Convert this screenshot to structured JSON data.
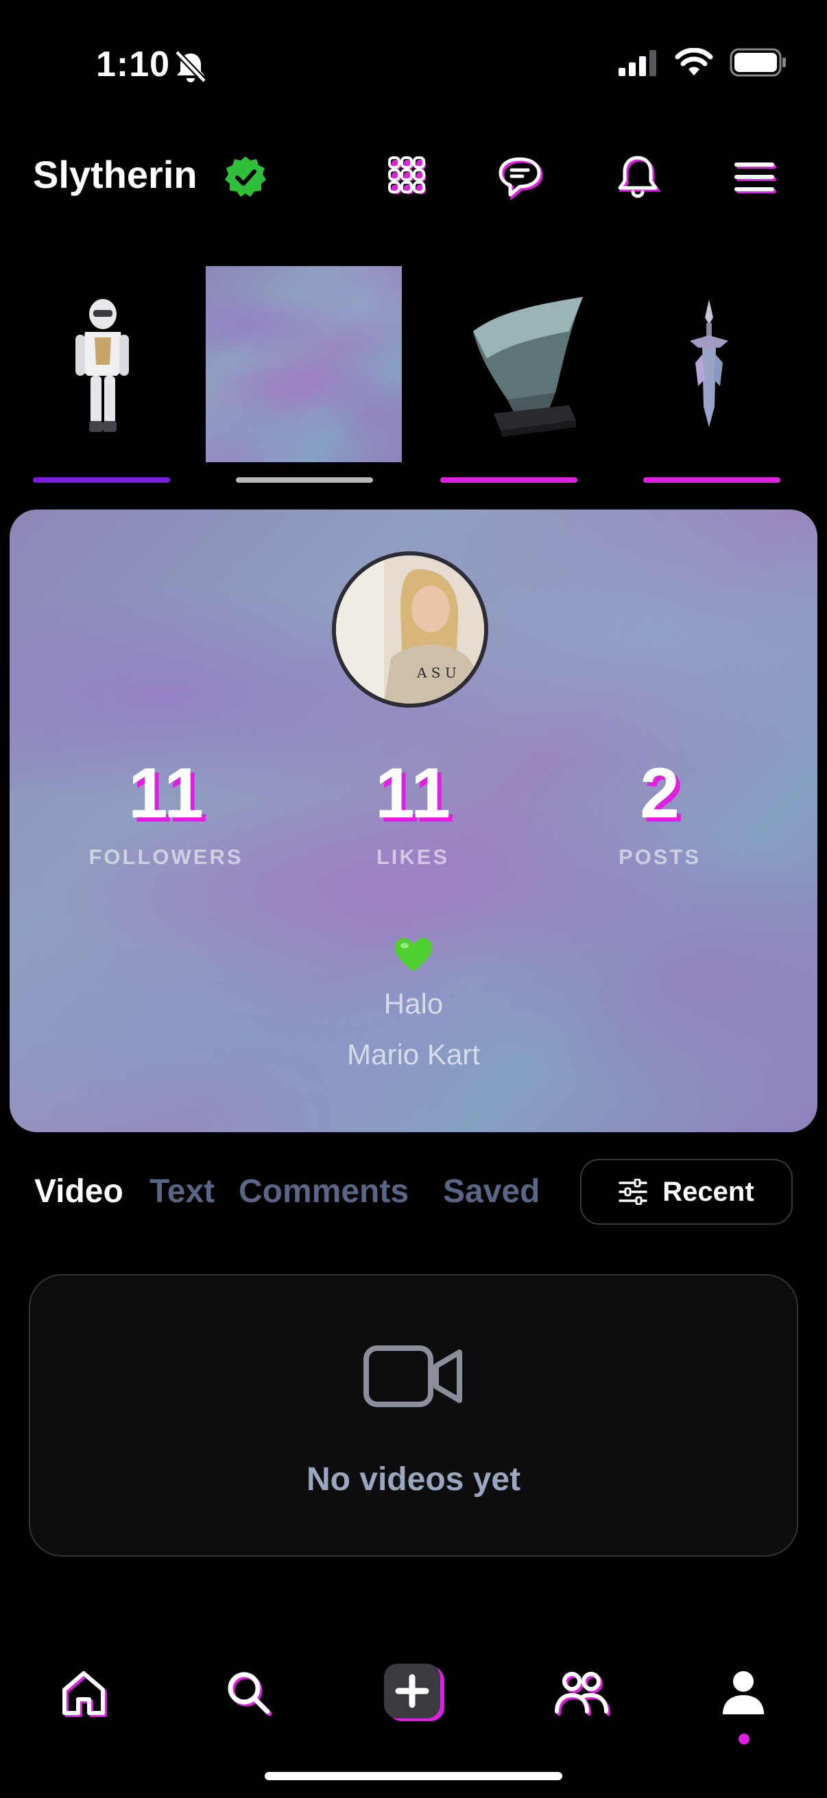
{
  "status_bar": {
    "time": "1:10"
  },
  "header": {
    "title": "Slytherin",
    "icons": [
      "verified-badge-icon",
      "grid-icon",
      "chat-icon",
      "bell-icon",
      "menu-icon"
    ]
  },
  "badges": [
    {
      "name": "armored-figure",
      "bar_color": "#7a1fe0"
    },
    {
      "name": "marble-tile",
      "bar_color": "#b8b8b8"
    },
    {
      "name": "glass-trophy",
      "bar_color": "#e020e0"
    },
    {
      "name": "crystal-sword",
      "bar_color": "#e020e0"
    }
  ],
  "profile": {
    "stats": [
      {
        "value": "11",
        "label": "FOLLOWERS"
      },
      {
        "value": "11",
        "label": "LIKES"
      },
      {
        "value": "2",
        "label": "POSTS"
      }
    ],
    "heart_emoji": "💚",
    "bio_lines": [
      "Halo",
      "Mario Kart"
    ]
  },
  "tabs": {
    "items": [
      {
        "label": "Video",
        "active": true
      },
      {
        "label": "Text",
        "active": false
      },
      {
        "label": "Comments",
        "active": false
      },
      {
        "label": "Saved",
        "active": false
      }
    ],
    "sort_label": "Recent"
  },
  "empty_state": {
    "text": "No videos yet"
  },
  "bottom_nav": {
    "items": [
      "home",
      "search",
      "create",
      "friends",
      "profile"
    ],
    "active": "profile"
  },
  "colors": {
    "accent": "#e020e0",
    "purple": "#7a1fe0",
    "verified_green": "#2fbf3a"
  }
}
